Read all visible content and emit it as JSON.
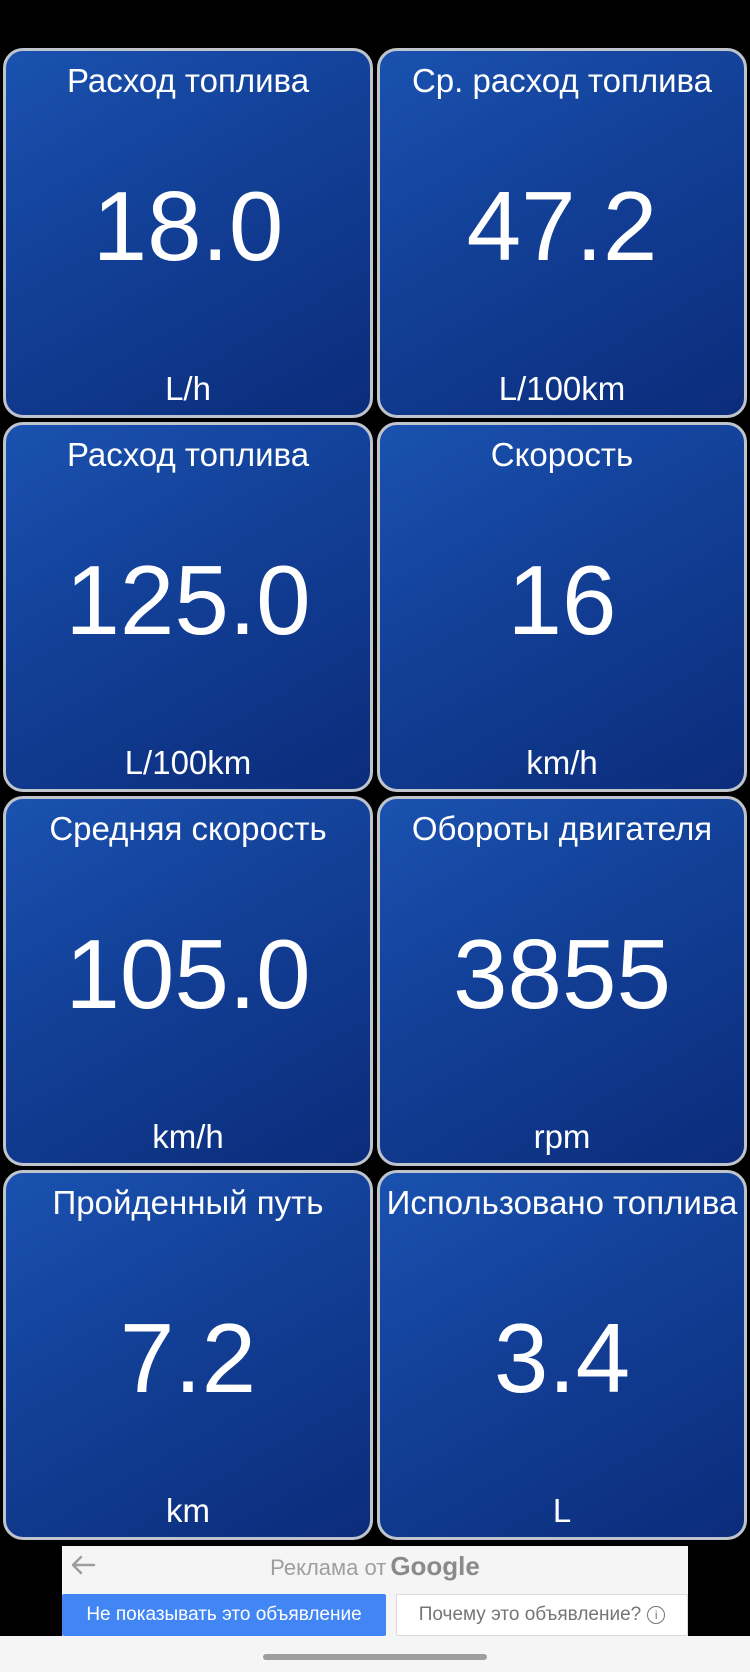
{
  "tiles": [
    {
      "title": "Расход топлива",
      "value": "18.0",
      "unit": "L/h"
    },
    {
      "title": "Ср. расход топлива",
      "value": "47.2",
      "unit": "L/100km"
    },
    {
      "title": "Расход топлива",
      "value": "125.0",
      "unit": "L/100km"
    },
    {
      "title": "Скорость",
      "value": "16",
      "unit": "km/h"
    },
    {
      "title": "Средняя скорость",
      "value": "105.0",
      "unit": "km/h"
    },
    {
      "title": "Обороты двигателя",
      "value": "3855",
      "unit": "rpm"
    },
    {
      "title": "Пройденный путь",
      "value": "7.2",
      "unit": "km"
    },
    {
      "title": "Использовано топлива",
      "value": "3.4",
      "unit": "L"
    }
  ],
  "ad": {
    "header_text": "Реклама от",
    "brand": "Google",
    "hide_button": "Не показывать это объявление",
    "why_button": "Почему это объявление?",
    "info_icon_glyph": "i",
    "back_icon": "arrow-left-icon"
  },
  "colors": {
    "tile_top": "#1a52b0",
    "tile_bottom": "#0b2c7a",
    "tile_border": "#bfc3cc",
    "ad_button": "#4285f4"
  }
}
